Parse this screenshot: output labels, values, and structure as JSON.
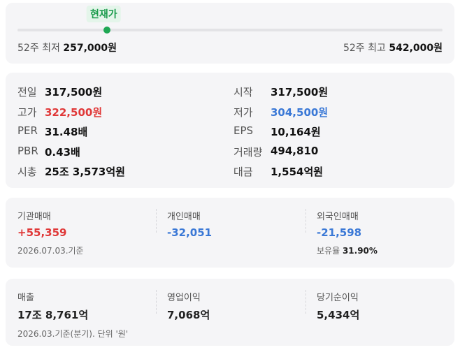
{
  "range": {
    "current_label": "현재가",
    "position_fraction": 0.211,
    "low_label": "52주 최저",
    "low_value": "257,000원",
    "high_label": "52주 최고",
    "high_value": "542,000원"
  },
  "detail": {
    "left": [
      {
        "label": "전일",
        "value": "317,500원",
        "tone": "normal"
      },
      {
        "label": "고가",
        "value": "322,500원",
        "tone": "up"
      },
      {
        "label": "PER",
        "value": "31.48배",
        "tone": "normal"
      },
      {
        "label": "PBR",
        "value": "0.43배",
        "tone": "normal"
      },
      {
        "label": "시총",
        "value": "25조 3,573억원",
        "tone": "normal"
      }
    ],
    "right": [
      {
        "label": "시작",
        "value": "317,500원",
        "tone": "normal"
      },
      {
        "label": "저가",
        "value": "304,500원",
        "tone": "down"
      },
      {
        "label": "EPS",
        "value": "10,164원",
        "tone": "normal"
      },
      {
        "label": "거래량",
        "value": "494,810",
        "tone": "normal"
      },
      {
        "label": "대금",
        "value": "1,554억원",
        "tone": "normal"
      }
    ]
  },
  "investor": {
    "institution": {
      "label": "기관매매",
      "value": "+55,359"
    },
    "individual": {
      "label": "개인매매",
      "value": "-32,051"
    },
    "foreign": {
      "label": "외국인매매",
      "value": "-21,598"
    },
    "date_note": "2026.07.03.기준",
    "holding_label": "보유율",
    "holding_value": "31.90%"
  },
  "financial": {
    "revenue": {
      "label": "매출",
      "value": "17조 8,761억"
    },
    "operating_profit": {
      "label": "영업이익",
      "value": "7,068억"
    },
    "net_income": {
      "label": "당기순이익",
      "value": "5,434억"
    },
    "note": "2026.03.기준(분기). 단위 '원'"
  },
  "colors": {
    "up": "#e03838",
    "down": "#3a78d6",
    "accent": "#1fa854"
  }
}
